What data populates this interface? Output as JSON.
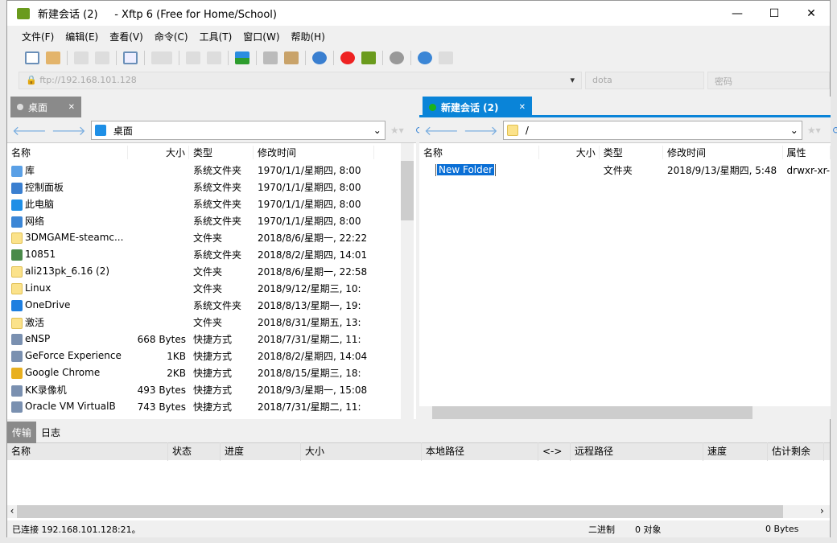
{
  "window": {
    "title": "新建会话 (2)     - Xftp 6 (Free for Home/School)",
    "minimize": "—",
    "maximize": "☐",
    "close": "✕"
  },
  "menu": [
    "文件(F)",
    "编辑(E)",
    "查看(V)",
    "命令(C)",
    "工具(T)",
    "窗口(W)",
    "帮助(H)"
  ],
  "address": {
    "url": "ftp://192.168.101.128",
    "user": "dota",
    "password_placeholder": "密码"
  },
  "left": {
    "tab": "桌面",
    "path": "桌面",
    "columns": [
      "名称",
      "大小",
      "类型",
      "修改时间"
    ],
    "rows": [
      [
        "库",
        "",
        "系统文件夹",
        "1970/1/1/星期四, 8:00",
        "lib"
      ],
      [
        "控制面板",
        "",
        "系统文件夹",
        "1970/1/1/星期四, 8:00",
        "panel"
      ],
      [
        "此电脑",
        "",
        "系统文件夹",
        "1970/1/1/星期四, 8:00",
        "pc"
      ],
      [
        "网络",
        "",
        "系统文件夹",
        "1970/1/1/星期四, 8:00",
        "net"
      ],
      [
        "3DMGAME-steamc...",
        "",
        "文件夹",
        "2018/8/6/星期一, 22:22",
        "folder"
      ],
      [
        "10851",
        "",
        "系统文件夹",
        "2018/8/2/星期四, 14:01",
        "user"
      ],
      [
        "ali213pk_6.16 (2)",
        "",
        "文件夹",
        "2018/8/6/星期一, 22:58",
        "folder"
      ],
      [
        "Linux",
        "",
        "文件夹",
        "2018/9/12/星期三, 10:",
        "folder"
      ],
      [
        "OneDrive",
        "",
        "系统文件夹",
        "2018/8/13/星期一, 19:",
        "cloud"
      ],
      [
        "激活",
        "",
        "文件夹",
        "2018/8/31/星期五, 13:",
        "folder"
      ],
      [
        "eNSP",
        "668 Bytes",
        "快捷方式",
        "2018/7/31/星期二, 11:",
        "shortcut"
      ],
      [
        "GeForce Experience",
        "1KB",
        "快捷方式",
        "2018/8/2/星期四, 14:04",
        "shortcut"
      ],
      [
        "Google Chrome",
        "2KB",
        "快捷方式",
        "2018/8/15/星期三, 18:",
        "chrome"
      ],
      [
        "KK录像机",
        "493 Bytes",
        "快捷方式",
        "2018/9/3/星期一, 15:08",
        "shortcut"
      ],
      [
        "Oracle VM VirtualB",
        "743 Bytes",
        "快捷方式",
        "2018/7/31/星期二, 11:",
        "shortcut"
      ]
    ]
  },
  "right": {
    "tab": "新建会话 (2)",
    "path": "/",
    "columns": [
      "名称",
      "大小",
      "类型",
      "修改时间",
      "属性"
    ],
    "rows": [
      [
        "New Folder",
        "",
        "文件夹",
        "2018/9/13/星期四, 5:48",
        "drwxr-xr-"
      ]
    ]
  },
  "transfer": {
    "tabs": [
      "传输",
      "日志"
    ],
    "columns": [
      "名称",
      "状态",
      "进度",
      "大小",
      "本地路径",
      "<->",
      "远程路径",
      "速度",
      "估计剩余"
    ]
  },
  "status": {
    "connected": "已连接 192.168.101.128:21。",
    "mode": "二进制",
    "objects": "0 对象",
    "size": "0 Bytes"
  },
  "colors": {
    "accent": "#0a84d8",
    "connected": "#1bb31b"
  }
}
